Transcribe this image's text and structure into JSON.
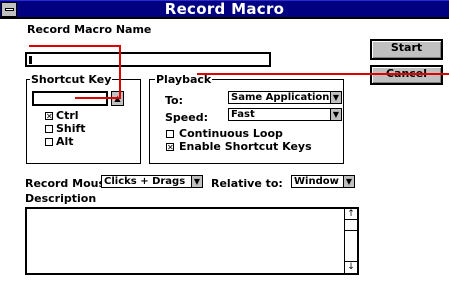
{
  "window": {
    "title": "Record Macro",
    "menu_icon": "control-menu-icon"
  },
  "record_macro_name": {
    "label": "Record Macro Name",
    "value": ""
  },
  "buttons": {
    "start": "Start",
    "cancel": "Cancel"
  },
  "shortcut_key": {
    "legend": "Shortcut Key",
    "value": "",
    "ctrl": {
      "label": "Ctrl",
      "checked": true
    },
    "shift": {
      "label": "Shift",
      "checked": false
    },
    "alt": {
      "label": "Alt",
      "checked": false
    }
  },
  "playback": {
    "legend": "Playback",
    "to_label": "To:",
    "to_value": "Same Application",
    "speed_label": "Speed:",
    "speed_value": "Fast",
    "continuous_loop": {
      "label": "Continuous Loop",
      "checked": false
    },
    "enable_shortcut_keys": {
      "label": "Enable Shortcut Keys",
      "checked": true
    }
  },
  "record_mouse": {
    "label": "Record Mouse:",
    "value": "Clicks + Drags"
  },
  "relative_to": {
    "label": "Relative to:",
    "value": "Window"
  },
  "description": {
    "label": "Description",
    "value": ""
  }
}
